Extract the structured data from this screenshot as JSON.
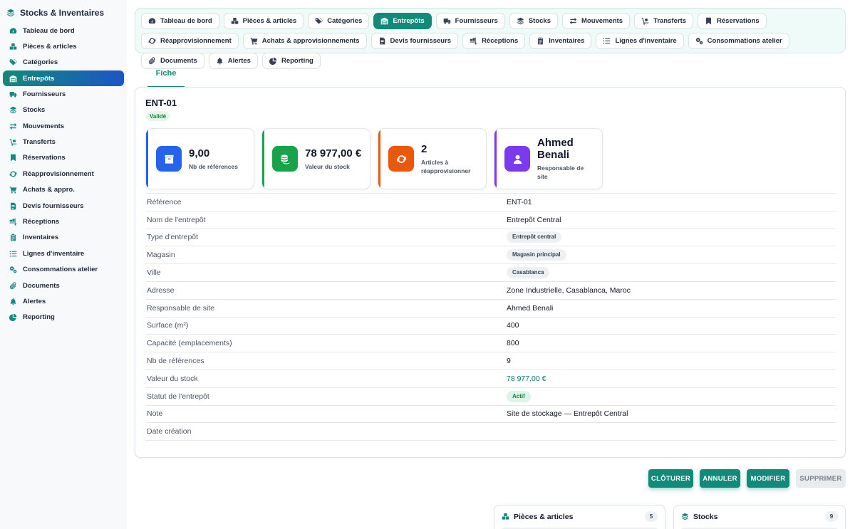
{
  "app": {
    "title": "Stocks & Inventaires"
  },
  "sidebar": {
    "items": [
      {
        "label": "Tableau de bord",
        "icon": "gauge-icon"
      },
      {
        "label": "Pièces & articles",
        "icon": "boxes-icon"
      },
      {
        "label": "Catégories",
        "icon": "tags-icon"
      },
      {
        "label": "Entrepôts",
        "icon": "warehouse-icon",
        "active": true
      },
      {
        "label": "Fournisseurs",
        "icon": "truck-icon"
      },
      {
        "label": "Stocks",
        "icon": "layers-icon"
      },
      {
        "label": "Mouvements",
        "icon": "arrows-icon"
      },
      {
        "label": "Transferts",
        "icon": "dolly-icon"
      },
      {
        "label": "Réservations",
        "icon": "bookmark-icon"
      },
      {
        "label": "Réapprovisionnement",
        "icon": "sync-icon"
      },
      {
        "label": "Achats & appro.",
        "icon": "cart-icon"
      },
      {
        "label": "Devis fournisseurs",
        "icon": "file-invoice-icon"
      },
      {
        "label": "Réceptions",
        "icon": "truck-ramp-icon"
      },
      {
        "label": "Inventaires",
        "icon": "clipboard-icon"
      },
      {
        "label": "Lignes d'inventaire",
        "icon": "list-icon"
      },
      {
        "label": "Consommations atelier",
        "icon": "cogs-icon"
      },
      {
        "label": "Documents",
        "icon": "paperclip-icon"
      },
      {
        "label": "Alertes",
        "icon": "bell-icon"
      },
      {
        "label": "Reporting",
        "icon": "pie-chart-icon"
      }
    ]
  },
  "tabs": [
    {
      "label": "Tableau de bord",
      "icon": "gauge-icon"
    },
    {
      "label": "Pièces & articles",
      "icon": "boxes-icon"
    },
    {
      "label": "Catégories",
      "icon": "tags-icon"
    },
    {
      "label": "Entrepôts",
      "icon": "warehouse-icon",
      "active": true
    },
    {
      "label": "Fournisseurs",
      "icon": "truck-icon"
    },
    {
      "label": "Stocks",
      "icon": "layers-icon"
    },
    {
      "label": "Mouvements",
      "icon": "arrows-icon"
    },
    {
      "label": "Transferts",
      "icon": "dolly-icon"
    },
    {
      "label": "Réservations",
      "icon": "bookmark-icon"
    },
    {
      "label": "Réapprovisionnement",
      "icon": "sync-icon"
    },
    {
      "label": "Achats & approvisionnements",
      "icon": "cart-icon"
    },
    {
      "label": "Devis fournisseurs",
      "icon": "file-invoice-icon"
    },
    {
      "label": "Réceptions",
      "icon": "truck-ramp-icon"
    },
    {
      "label": "Inventaires",
      "icon": "clipboard-icon"
    },
    {
      "label": "Lignes d'inventaire",
      "icon": "list-icon"
    },
    {
      "label": "Consommations atelier",
      "icon": "cogs-icon"
    },
    {
      "label": "Documents",
      "icon": "paperclip-icon"
    },
    {
      "label": "Alertes",
      "icon": "bell-icon"
    },
    {
      "label": "Reporting",
      "icon": "pie-chart-icon"
    }
  ],
  "subtab": {
    "label": "Fiche"
  },
  "record": {
    "code": "ENT-01",
    "status": "Validé"
  },
  "kpis": [
    {
      "value": "9,00",
      "label": "Nb de références",
      "color": "#2563eb",
      "icon": "box-icon"
    },
    {
      "value": "78 977,00 €",
      "label": "Valeur du stock",
      "color": "#16a34a",
      "icon": "coins-icon"
    },
    {
      "value": "2",
      "label": "Articles à réapprovisionner",
      "color": "#ea580c",
      "icon": "sync-icon"
    },
    {
      "value": "Ahmed Benali",
      "label": "Responsable de site",
      "color": "#7c3aed",
      "icon": "user-icon"
    }
  ],
  "fields": [
    {
      "label": "Référence",
      "value": "ENT-01",
      "kind": "text"
    },
    {
      "label": "Nom de l'entrepôt",
      "value": "Entrepôt Central",
      "kind": "text"
    },
    {
      "label": "Type d'entrepôt",
      "value": "Entrepôt central",
      "kind": "chip"
    },
    {
      "label": "Magasin",
      "value": "Magasin principal",
      "kind": "chip"
    },
    {
      "label": "Ville",
      "value": "Casablanca",
      "kind": "chip"
    },
    {
      "label": "Adresse",
      "value": "Zone Industrielle, Casablanca, Maroc",
      "kind": "text"
    },
    {
      "label": "Responsable de site",
      "value": "Ahmed Benali",
      "kind": "text"
    },
    {
      "label": "Surface (m²)",
      "value": "400",
      "kind": "text"
    },
    {
      "label": "Capacité (emplacements)",
      "value": "800",
      "kind": "text"
    },
    {
      "label": "Nb de références",
      "value": "9",
      "kind": "text"
    },
    {
      "label": "Valeur du stock",
      "value": "78 977,00 €",
      "kind": "money"
    },
    {
      "label": "Statut de l'entrepôt",
      "value": "Actif",
      "kind": "chip-green"
    },
    {
      "label": "Note",
      "value": "Site de stockage — Entrepôt Central",
      "kind": "text"
    },
    {
      "label": "Date création",
      "value": "",
      "kind": "text"
    }
  ],
  "actions": {
    "close_label": "CLÔTURER",
    "cancel_label": "ANNULER",
    "edit_label": "MODIFIER",
    "delete_label": "SUPPRIMER"
  },
  "related": [
    {
      "title": "Pièces & articles",
      "count": "5",
      "icon": "boxes-icon"
    },
    {
      "title": "Stocks",
      "count": "9",
      "icon": "layers-icon"
    }
  ],
  "colors": {
    "accent": "#128a7a",
    "accent_blue": "#1b55c7"
  }
}
